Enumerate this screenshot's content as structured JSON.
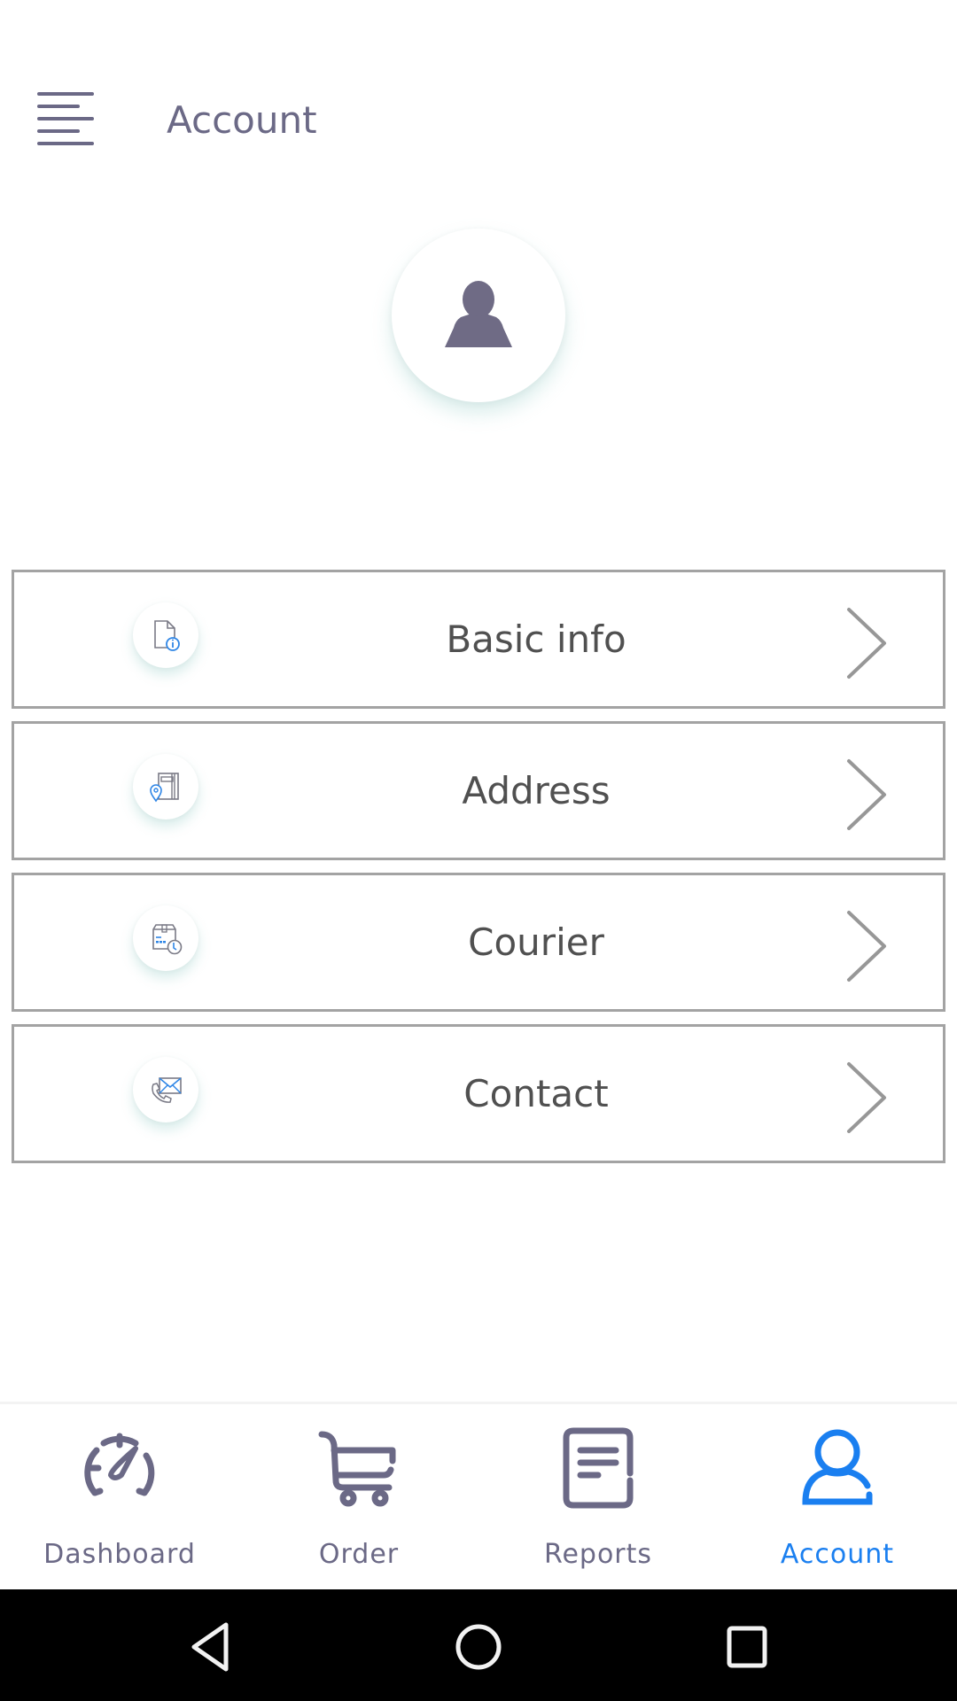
{
  "header": {
    "menu_icon": "hamburger-menu-icon",
    "title": "Account"
  },
  "profile": {
    "avatar_icon": "user-silhouette-icon"
  },
  "menu": [
    {
      "label": "Basic info",
      "icon": "document-info-icon"
    },
    {
      "label": "Address",
      "icon": "address-book-pin-icon"
    },
    {
      "label": "Courier",
      "icon": "package-clock-icon"
    },
    {
      "label": "Contact",
      "icon": "phone-envelope-icon"
    }
  ],
  "bottom_nav": {
    "active": "Account",
    "items": [
      {
        "label": "Dashboard",
        "icon": "speedometer-icon"
      },
      {
        "label": "Order",
        "icon": "shopping-cart-icon"
      },
      {
        "label": "Reports",
        "icon": "report-document-icon"
      },
      {
        "label": "Account",
        "icon": "user-icon"
      }
    ]
  },
  "system_nav": {
    "back": "back-icon",
    "home": "home-icon",
    "recents": "recents-icon"
  },
  "colors": {
    "primary_text": "#6b6986",
    "accent": "#1a7ff0",
    "row_border": "#a3a3a3",
    "row_label": "#505050"
  }
}
